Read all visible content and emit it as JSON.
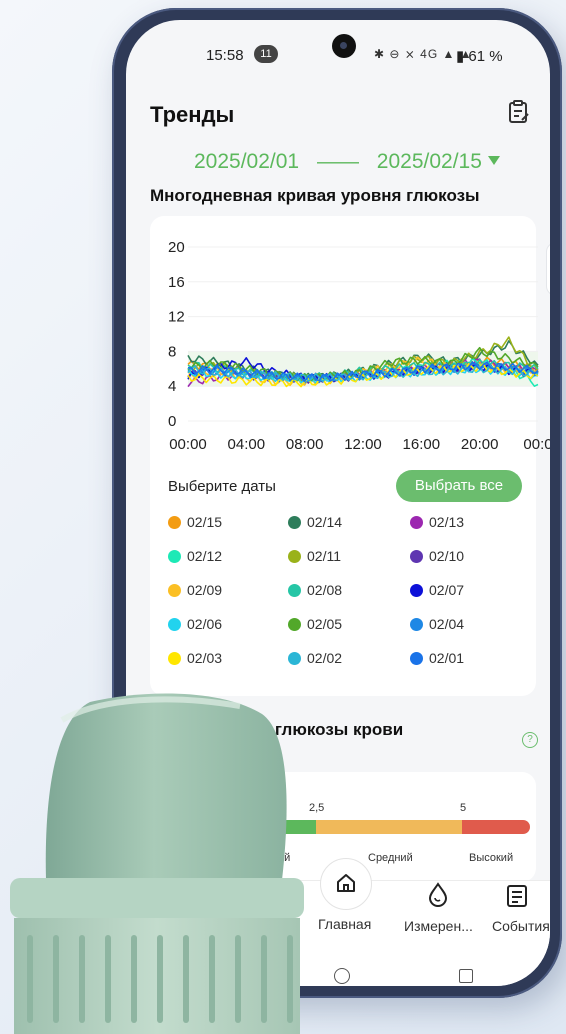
{
  "status_bar": {
    "time": "15:58",
    "notification_count": "11",
    "icons": "✱ ⊖ ⨯ 4G ▲ ▲",
    "battery": "61 %"
  },
  "header": {
    "title": "Тренды"
  },
  "date_range": {
    "start": "2025/02/01",
    "separator": "——",
    "end": "2025/02/15"
  },
  "multi_day": {
    "title": "Многодневная кривая уровня глюкозы"
  },
  "chart_data": {
    "type": "line",
    "title": "",
    "xlabel": "",
    "ylabel": "",
    "y_ticks": [
      "20",
      "16",
      "12",
      "8",
      "4",
      "0"
    ],
    "x_ticks": [
      "00:00",
      "04:00",
      "08:00",
      "12:00",
      "16:00",
      "20:00",
      "00:0"
    ],
    "ylim": [
      0,
      20
    ],
    "target_range": [
      4,
      8
    ],
    "x": [
      "00:00",
      "02:00",
      "04:00",
      "06:00",
      "08:00",
      "10:00",
      "12:00",
      "14:00",
      "16:00",
      "18:00",
      "20:00",
      "22:00",
      "24:00"
    ],
    "series": [
      {
        "color": "#f39c12",
        "values": [
          6.5,
          6.2,
          5.5,
          5.0,
          4.8,
          5.0,
          5.2,
          5.8,
          6.0,
          6.5,
          7.0,
          6.6,
          6.0
        ]
      },
      {
        "color": "#2e7d5b",
        "values": [
          7.2,
          6.8,
          6.0,
          5.4,
          5.0,
          5.2,
          5.8,
          6.6,
          7.4,
          6.8,
          7.6,
          8.8,
          6.4
        ]
      },
      {
        "color": "#9c27b0",
        "values": [
          4.4,
          5.0,
          5.4,
          5.2,
          5.0,
          5.1,
          5.3,
          5.6,
          6.0,
          6.4,
          6.8,
          6.2,
          5.8
        ]
      },
      {
        "color": "#1de9b6",
        "values": [
          5.8,
          6.0,
          5.6,
          5.2,
          4.9,
          5.0,
          5.4,
          5.8,
          6.2,
          6.6,
          6.8,
          6.0,
          4.2
        ]
      },
      {
        "color": "#9ab21a",
        "values": [
          6.0,
          6.4,
          5.8,
          5.2,
          5.0,
          5.1,
          5.6,
          6.4,
          7.2,
          6.6,
          7.8,
          9.2,
          5.6
        ]
      },
      {
        "color": "#5e35b1",
        "values": [
          5.4,
          5.6,
          5.2,
          5.0,
          4.8,
          4.9,
          5.2,
          5.6,
          5.8,
          6.0,
          6.2,
          5.8,
          5.4
        ]
      },
      {
        "color": "#fbbf24",
        "values": [
          5.2,
          5.8,
          5.0,
          4.6,
          4.5,
          4.8,
          5.6,
          6.2,
          7.0,
          6.2,
          6.4,
          6.0,
          5.8
        ]
      },
      {
        "color": "#26c6a6",
        "values": [
          6.6,
          6.0,
          5.6,
          5.2,
          5.0,
          5.2,
          5.8,
          6.0,
          6.4,
          6.2,
          6.6,
          6.4,
          6.0
        ]
      },
      {
        "color": "#0d10d8",
        "values": [
          5.0,
          6.2,
          6.8,
          5.6,
          5.0,
          5.0,
          5.2,
          5.4,
          5.8,
          6.0,
          6.2,
          5.8,
          5.6
        ]
      },
      {
        "color": "#22d3ee",
        "values": [
          5.6,
          5.4,
          5.2,
          5.0,
          4.8,
          4.9,
          5.0,
          5.4,
          5.6,
          5.8,
          6.0,
          5.6,
          5.2
        ]
      },
      {
        "color": "#52a82a",
        "values": [
          6.2,
          6.6,
          6.0,
          5.4,
          5.0,
          5.2,
          5.6,
          6.8,
          7.0,
          6.6,
          8.0,
          7.2,
          6.2
        ]
      },
      {
        "color": "#1e88e5",
        "values": [
          5.6,
          5.8,
          5.4,
          5.0,
          4.8,
          5.0,
          5.2,
          5.6,
          5.8,
          6.0,
          6.4,
          6.0,
          5.6
        ]
      },
      {
        "color": "#ffe600",
        "values": [
          5.0,
          4.8,
          4.6,
          4.4,
          4.4,
          4.6,
          5.0,
          5.4,
          5.8,
          6.0,
          6.2,
          5.6,
          5.2
        ]
      },
      {
        "color": "#2bb6d6",
        "values": [
          6.0,
          5.6,
          5.4,
          5.2,
          5.0,
          5.0,
          5.2,
          5.4,
          5.6,
          5.8,
          6.0,
          5.8,
          5.4
        ]
      },
      {
        "color": "#1a73e8",
        "values": [
          5.8,
          6.0,
          5.6,
          5.2,
          5.0,
          5.0,
          5.4,
          5.6,
          6.0,
          6.2,
          6.4,
          6.2,
          5.8
        ]
      }
    ]
  },
  "date_picker": {
    "label": "Выберите даты",
    "select_all": "Выбрать все",
    "dates": [
      {
        "label": "02/15",
        "color": "#f39c12"
      },
      {
        "label": "02/14",
        "color": "#2e7d5b"
      },
      {
        "label": "02/13",
        "color": "#9c27b0"
      },
      {
        "label": "02/12",
        "color": "#1de9b6"
      },
      {
        "label": "02/11",
        "color": "#9ab21a"
      },
      {
        "label": "02/10",
        "color": "#5e35b1"
      },
      {
        "label": "02/09",
        "color": "#fbbf24"
      },
      {
        "label": "02/08",
        "color": "#26c6a6"
      },
      {
        "label": "02/07",
        "color": "#0d10d8"
      },
      {
        "label": "02/06",
        "color": "#22d3ee"
      },
      {
        "label": "02/05",
        "color": "#52a82a"
      },
      {
        "label": "02/04",
        "color": "#1e88e5"
      },
      {
        "label": "02/03",
        "color": "#ffe600"
      },
      {
        "label": "02/02",
        "color": "#2bb6d6"
      },
      {
        "label": "02/01",
        "color": "#1a73e8"
      }
    ]
  },
  "low_glucose": {
    "title": "изкого уровня глюкозы крови",
    "help": "?",
    "tick_1": "2,5",
    "tick_2": "5",
    "low_label": "изкий",
    "mid_label": "Средний",
    "high_label": "Высокий",
    "colors": {
      "low": "#5cb85c",
      "mid": "#f0b95a",
      "high": "#e05b4c"
    }
  },
  "bottom_nav": {
    "home": "Главная",
    "measure": "Измерен...",
    "events": "События"
  },
  "colors": {
    "accent": "#5cb85c",
    "button": "#6bbd6e",
    "phone_frame": "#2f3a57"
  }
}
